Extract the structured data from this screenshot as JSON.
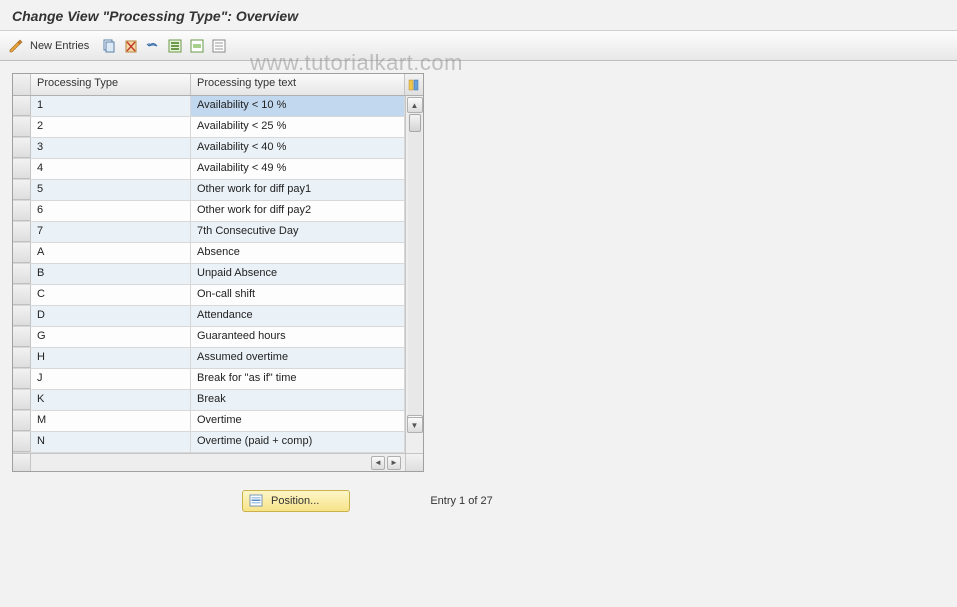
{
  "title": "Change View \"Processing Type\": Overview",
  "watermark": "www.tutorialkart.com",
  "toolbar": {
    "new_entries_label": "New Entries"
  },
  "table": {
    "columns": {
      "col1": "Processing Type",
      "col2": "Processing type text"
    },
    "rows": [
      {
        "type": "1",
        "text": "Availability < 10 %",
        "selected": true
      },
      {
        "type": "2",
        "text": "Availability < 25 %"
      },
      {
        "type": "3",
        "text": "Availability < 40 %"
      },
      {
        "type": "4",
        "text": "Availability < 49 %"
      },
      {
        "type": "5",
        "text": "Other work for diff pay1"
      },
      {
        "type": "6",
        "text": "Other work for diff pay2"
      },
      {
        "type": "7",
        "text": "7th Consecutive Day"
      },
      {
        "type": "A",
        "text": "Absence"
      },
      {
        "type": "B",
        "text": "Unpaid Absence"
      },
      {
        "type": "C",
        "text": "On-call shift"
      },
      {
        "type": "D",
        "text": "Attendance"
      },
      {
        "type": "G",
        "text": "Guaranteed hours"
      },
      {
        "type": "H",
        "text": "Assumed overtime"
      },
      {
        "type": "J",
        "text": "Break for \"as if\" time"
      },
      {
        "type": "K",
        "text": "Break"
      },
      {
        "type": "M",
        "text": "Overtime"
      },
      {
        "type": "N",
        "text": "Overtime (paid + comp)"
      }
    ]
  },
  "footer": {
    "position_label": "Position...",
    "entry_label": "Entry 1 of 27"
  }
}
